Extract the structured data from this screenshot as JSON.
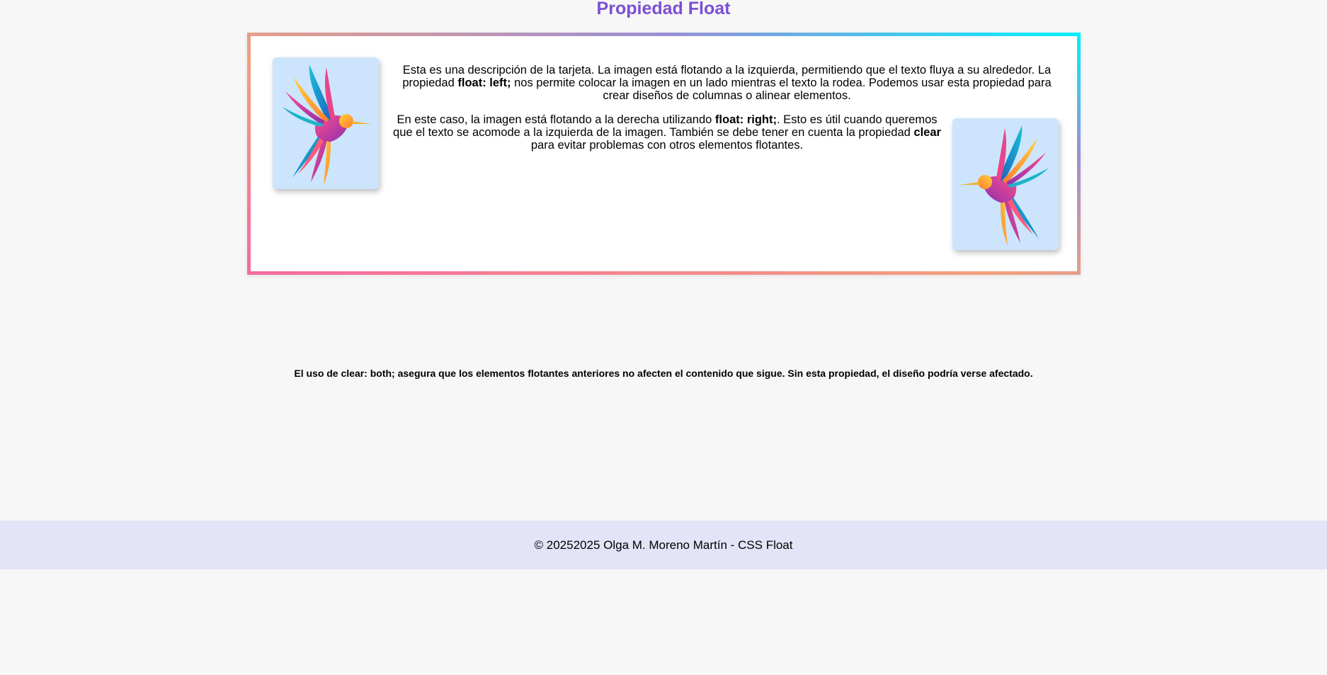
{
  "header": {
    "title": "Propiedad Float",
    "title_color": "#7b4fd4"
  },
  "card": {
    "image_left_alt": "hummingbird-illustration",
    "image_right_alt": "hummingbird-illustration",
    "paragraph1": {
      "t1": "Esta es una descripción de la tarjeta. La imagen está flotando a la izquierda, permitiendo que el texto fluya a su alrededor. La propiedad ",
      "b1": "float: left;",
      "t2": " nos permite colocar la imagen en un lado mientras el texto la rodea. Podemos usar esta propiedad para crear diseños de columnas o alinear elementos."
    },
    "paragraph2": {
      "t1": "En este caso, la imagen está flotando a la derecha utilizando ",
      "b1": "float: right;",
      "t2": ". Esto es útil cuando queremos que el texto se acomode a la izquierda de la imagen. También se debe tener en cuenta la propiedad ",
      "b2": "clear",
      "t3": " para evitar problemas con otros elementos flotantes."
    },
    "border_colors": [
      "#f76aa0",
      "#f3a07c",
      "#9b8fd6",
      "#00f0ff"
    ],
    "image_bg": "#cce5fc"
  },
  "clear_note": "El uso de clear: both; asegura que los elementos flotantes anteriores no afecten el contenido que sigue. Sin esta propiedad, el diseño podría verse afectado.",
  "footer": {
    "text": "© 20252025 Olga M. Moreno Martín - CSS Float",
    "background": "#e3e4f7"
  }
}
